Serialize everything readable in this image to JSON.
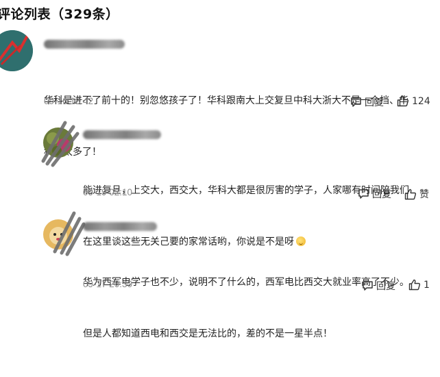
{
  "header": {
    "title": "评论列表（329条）"
  },
  "comments": [
    {
      "text_line1": "华科是进不了前十的！别忽悠孩子了！华科跟南大上交复旦中科大浙大不是一个挡、华",
      "text_line2": "科差太多了！",
      "time": "09-16 18:42",
      "reply_label": "回复",
      "like_count": "124"
    },
    {
      "text_line1": "能进复旦，上交大，西交大，华科大都是很厉害的学子，人家哪有时间陪我们",
      "text_line2": "在这里谈这些无关己要的家常话哟，你说是不是呀",
      "time": "09-19 02:10",
      "reply_label": "回复",
      "like_label": "赞"
    },
    {
      "text_line1": "华为西军电学子也不少，说明不了什么的，西军电比西交大就业率高了不少。",
      "text_line2": "但是人都知道西电和西交是无法比的，差的不是一星半点！",
      "time": "09-17 20:30",
      "reply_label": "回复",
      "like_count": "1"
    }
  ],
  "icons": {
    "reply": "comment-bubble-icon",
    "like": "thumbs-up-icon",
    "emoji": "smile-emoji-icon"
  },
  "colors": {
    "text": "#222222",
    "muted": "#8a8a8a",
    "icon": "#333333"
  }
}
